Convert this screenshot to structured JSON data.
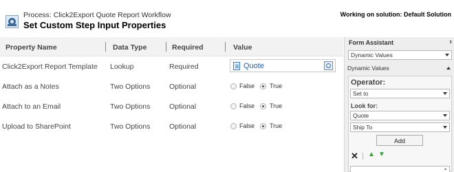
{
  "header": {
    "process": "Process: Click2Export Quote Report Workflow",
    "title": "Set Custom Step Input Properties",
    "solution": "Working on solution: Default Solution"
  },
  "grid": {
    "columns": [
      "Property Name",
      "Data Type",
      "Required",
      "Value"
    ],
    "rows": [
      {
        "name": "Click2Export Report Template",
        "type": "Lookup",
        "required": "Required",
        "value": "Quote"
      },
      {
        "name": "Attach as a Notes",
        "type": "Two Options",
        "required": "Optional",
        "value": "True"
      },
      {
        "name": "Attach to an Email",
        "type": "Two Options",
        "required": "Optional",
        "value": "True"
      },
      {
        "name": "Upload to SharePoint",
        "type": "Two Options",
        "required": "Optional",
        "value": "True"
      }
    ],
    "radio_false_label": "False",
    "radio_true_label": "True"
  },
  "form_assistant": {
    "title": "Form Assistant",
    "dynamic_values_select": "Dynamic Values",
    "dynamic_values_header": "Dynamic Values",
    "operator_label": "Operator:",
    "operator_value": "Set to",
    "look_for_label": "Look for:",
    "look_for_entity": "Quote",
    "look_for_field": "Ship To",
    "add_button": "Add",
    "icons": [
      "close-icon",
      "move-up-icon",
      "move-down-icon"
    ],
    "colors": {
      "move_icons": "#3aa13a",
      "lookup_value": "#1f62ad"
    }
  }
}
